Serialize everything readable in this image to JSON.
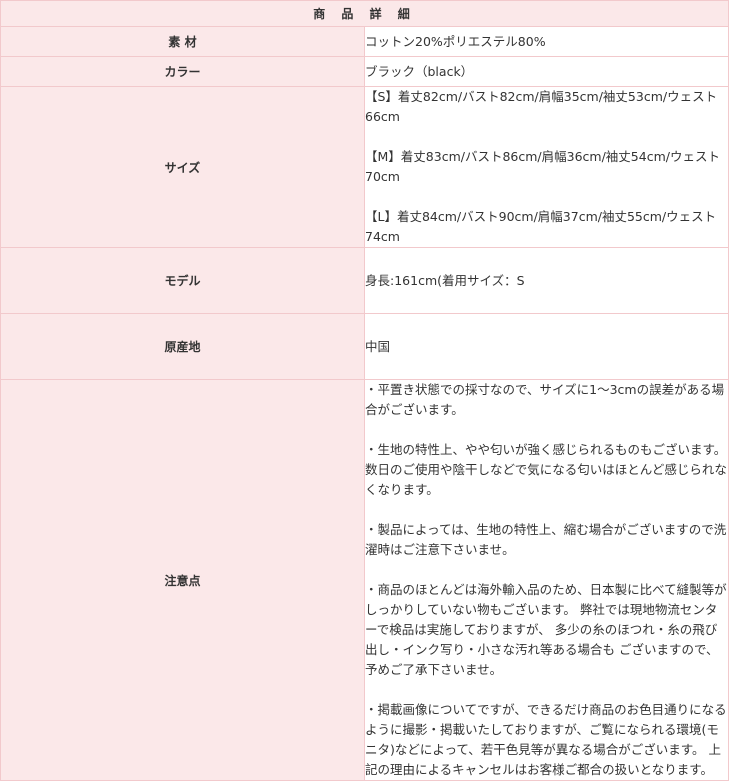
{
  "title": "商 品 詳 細",
  "rows": {
    "material": {
      "label": "素 材",
      "value": "コットン20%ポリエステル80%"
    },
    "color": {
      "label": "カラー",
      "value": "ブラック（black）"
    },
    "size": {
      "label": "サイズ",
      "lines": [
        "【S】着丈82cm/バスト82cm/肩幅35cm/袖丈53cm/ウェスト66cm",
        "【M】着丈83cm/バスト86cm/肩幅36cm/袖丈54cm/ウェスト70cm",
        "【L】着丈84cm/バスト90cm/肩幅37cm/袖丈55cm/ウェスト74cm"
      ]
    },
    "model": {
      "label": "モデル",
      "value": "身長:161cm(着用サイズ：S"
    },
    "origin": {
      "label": "原産地",
      "value": "中国"
    },
    "notes": {
      "label": "注意点",
      "paragraphs": [
        "・平置き状態での採寸なので、サイズに1～3cmの誤差がある場合がございます。",
        "・生地の特性上、やや匂いが強く感じられるものもございます。 数日のご使用や陰干しなどで気になる匂いはほとんど感じられなくなります。",
        "・製品によっては、生地の特性上、縮む場合がございますので洗濯時はご注意下さいませ。",
        "・商品のほとんどは海外輸入品のため、日本製に比べて縫製等が しっかりしていない物もございます。 弊社では現地物流センターで検品は実施しておりますが、 多少の糸のほつれ・糸の飛び出し・インク写り・小さな汚れ等ある場合も ございますので、予めご了承下さいませ。",
        "・掲載画像についてですが、できるだけ商品のお色目通りになるように撮影・掲載いたしておりますが、ご覧になられる環境(モニタ)などによって、若干色見等が異なる場合がございます。 上記の理由によるキャンセルはお客様ご都合の扱いとなります。"
      ]
    }
  }
}
